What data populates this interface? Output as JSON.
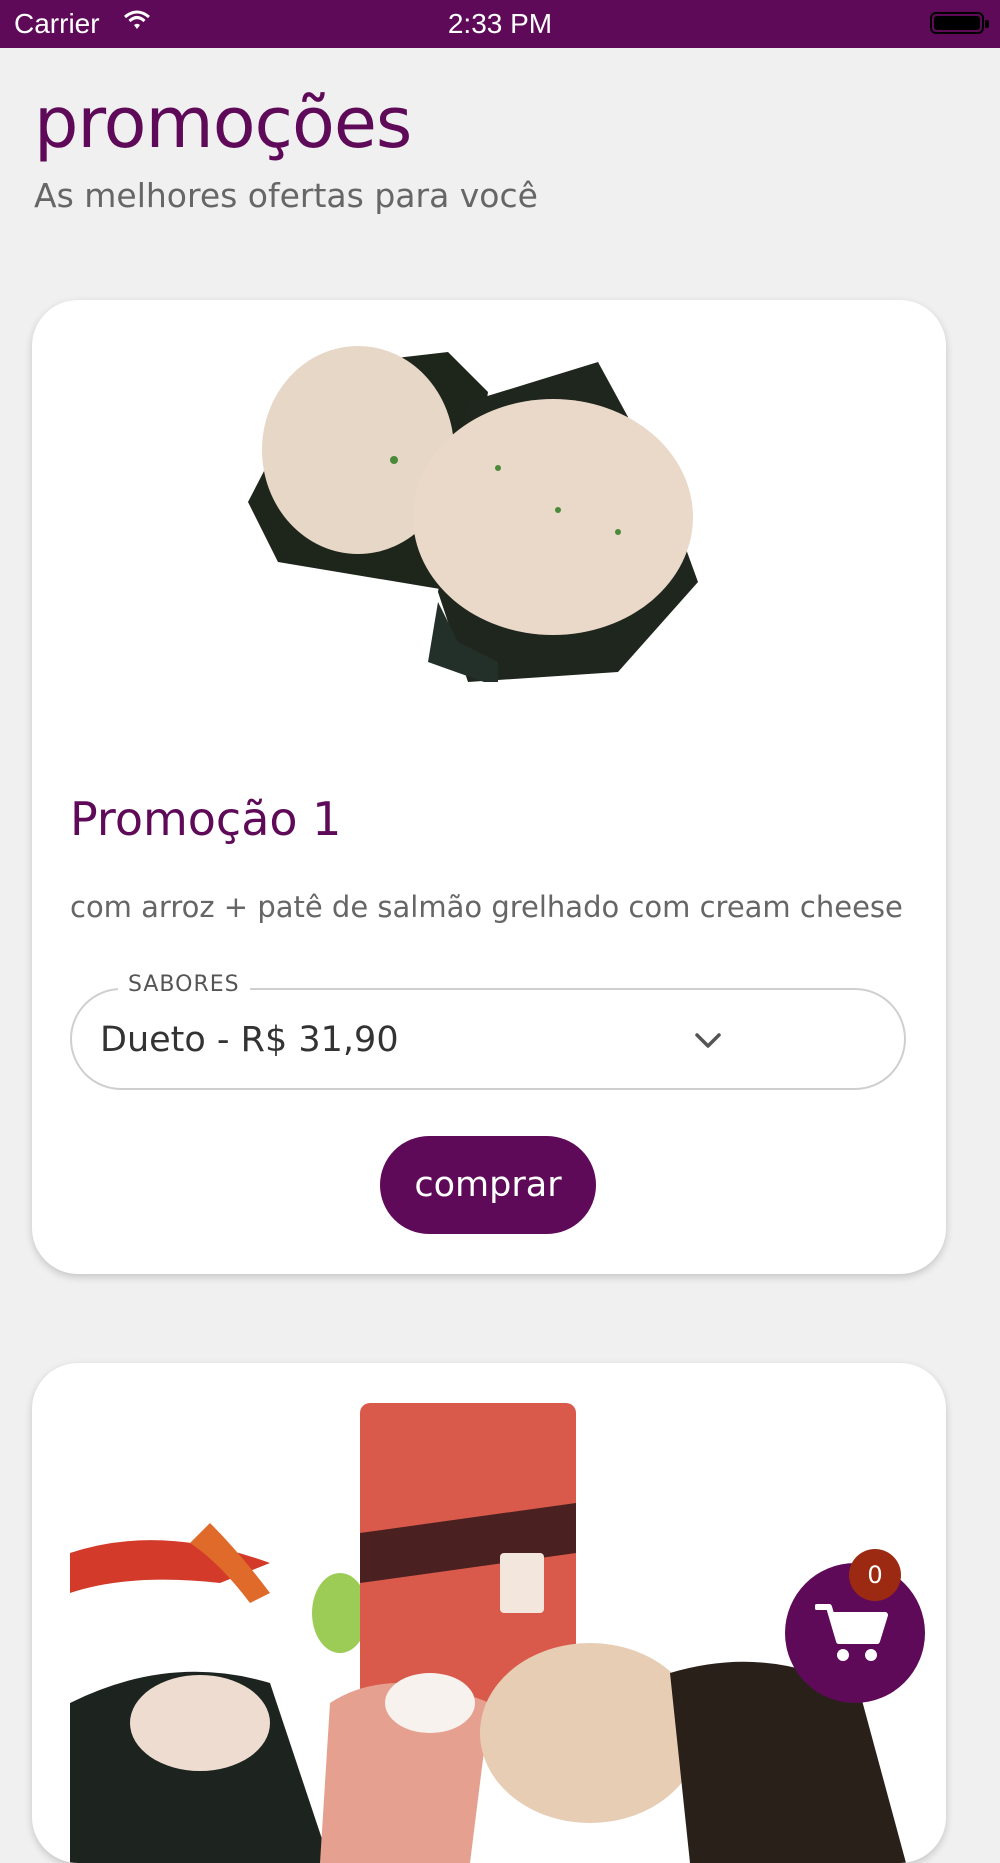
{
  "status_bar": {
    "carrier": "Carrier",
    "time": "2:33 PM"
  },
  "header": {
    "title": "promoções",
    "subtitle": "As melhores ofertas para você"
  },
  "promotions": [
    {
      "title": "Promoção 1",
      "description": "com arroz + patê de salmão grelhado com cream cheese",
      "select": {
        "label": "SABORES",
        "value": "Dueto - R$ 31,90"
      },
      "buy_label": "comprar",
      "image": "sushi-temaki-photo"
    },
    {
      "image": "sushi-and-soda-photo"
    }
  ],
  "cart": {
    "count": "0",
    "icon": "cart-icon"
  },
  "colors": {
    "brand": "#5e0a59",
    "badge": "#9c2a12",
    "background": "#f0f0f0"
  }
}
